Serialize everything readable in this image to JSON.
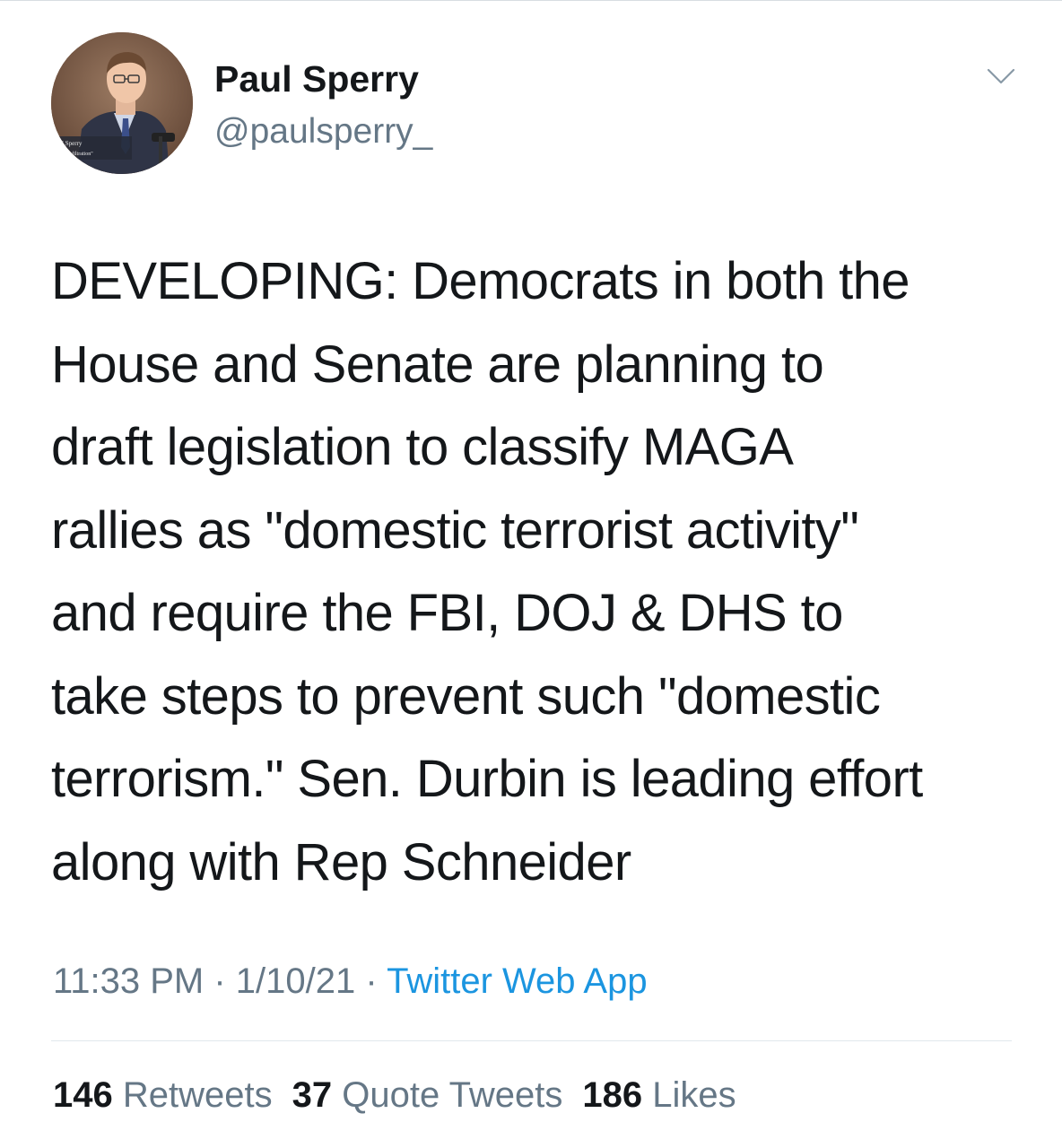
{
  "author": {
    "display_name": "Paul Sperry",
    "handle": "@paulsperry_",
    "avatar_caption_line1": "l Sperry",
    "avatar_caption_line2": "or, \"Infiltration\""
  },
  "tweet": {
    "text": "DEVELOPING: Democrats in both the\nHouse and Senate are planning to\ndraft legislation to classify MAGA\nrallies as \"domestic terrorist activity\"\nand require the FBI, DOJ & DHS to\ntake steps to prevent such \"domestic\nterrorism.\" Sen. Durbin is leading effort\nalong with Rep Schneider",
    "time": "11:33 PM",
    "separator": " · ",
    "date": "1/10/21",
    "source": "Twitter Web App"
  },
  "stats": {
    "retweets_count": "146",
    "retweets_label": "Retweets",
    "quotes_count": "37",
    "quotes_label": "Quote Tweets",
    "likes_count": "186",
    "likes_label": "Likes"
  },
  "icons": {
    "menu": "chevron-down-icon"
  },
  "colors": {
    "text_primary": "#14171a",
    "text_secondary": "#657786",
    "link": "#1b95e0",
    "divider": "#e1e8ed"
  }
}
